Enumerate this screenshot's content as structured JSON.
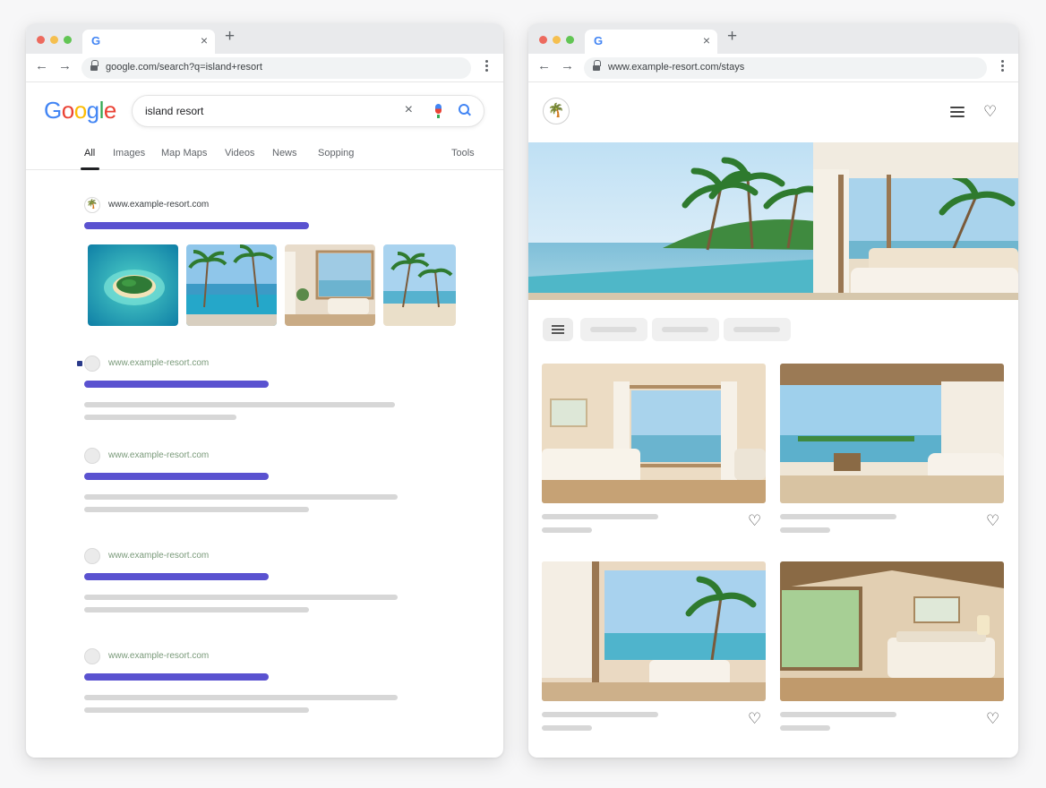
{
  "left_window": {
    "tab": {
      "favicon_letter": "G"
    },
    "new_tab_label": "+",
    "url": "google.com/search?q=island+resort",
    "google": {
      "logo_letters": [
        "G",
        "o",
        "o",
        "g",
        "l",
        "e"
      ],
      "query": "island resort",
      "clear_icon": "×",
      "tabs": [
        "All",
        "Images",
        "Map Maps",
        "Videos",
        "News",
        "Sopping"
      ],
      "tools_label": "Tools",
      "top_result_site": "www.example-resort.com",
      "results": [
        {
          "site": "www.example-resort.com"
        },
        {
          "site": "www.example-resort.com"
        },
        {
          "site": "www.example-resort.com"
        },
        {
          "site": "www.example-resort.com"
        }
      ]
    }
  },
  "right_window": {
    "tab": {
      "favicon_letter": "G"
    },
    "new_tab_label": "+",
    "url": "www.example-resort.com/stays",
    "header": {
      "logo_glyph": "🌴",
      "heart_glyph": "♡"
    },
    "card_heart_glyph": "♡"
  },
  "colors": {
    "traffic_red": "#ed6a5e",
    "traffic_yellow": "#f5bf4f",
    "traffic_green": "#62c554",
    "result_title_bar": "#5a52d0",
    "placeholder_bar": "#d7d7d7",
    "google_blue": "#4285f4"
  }
}
